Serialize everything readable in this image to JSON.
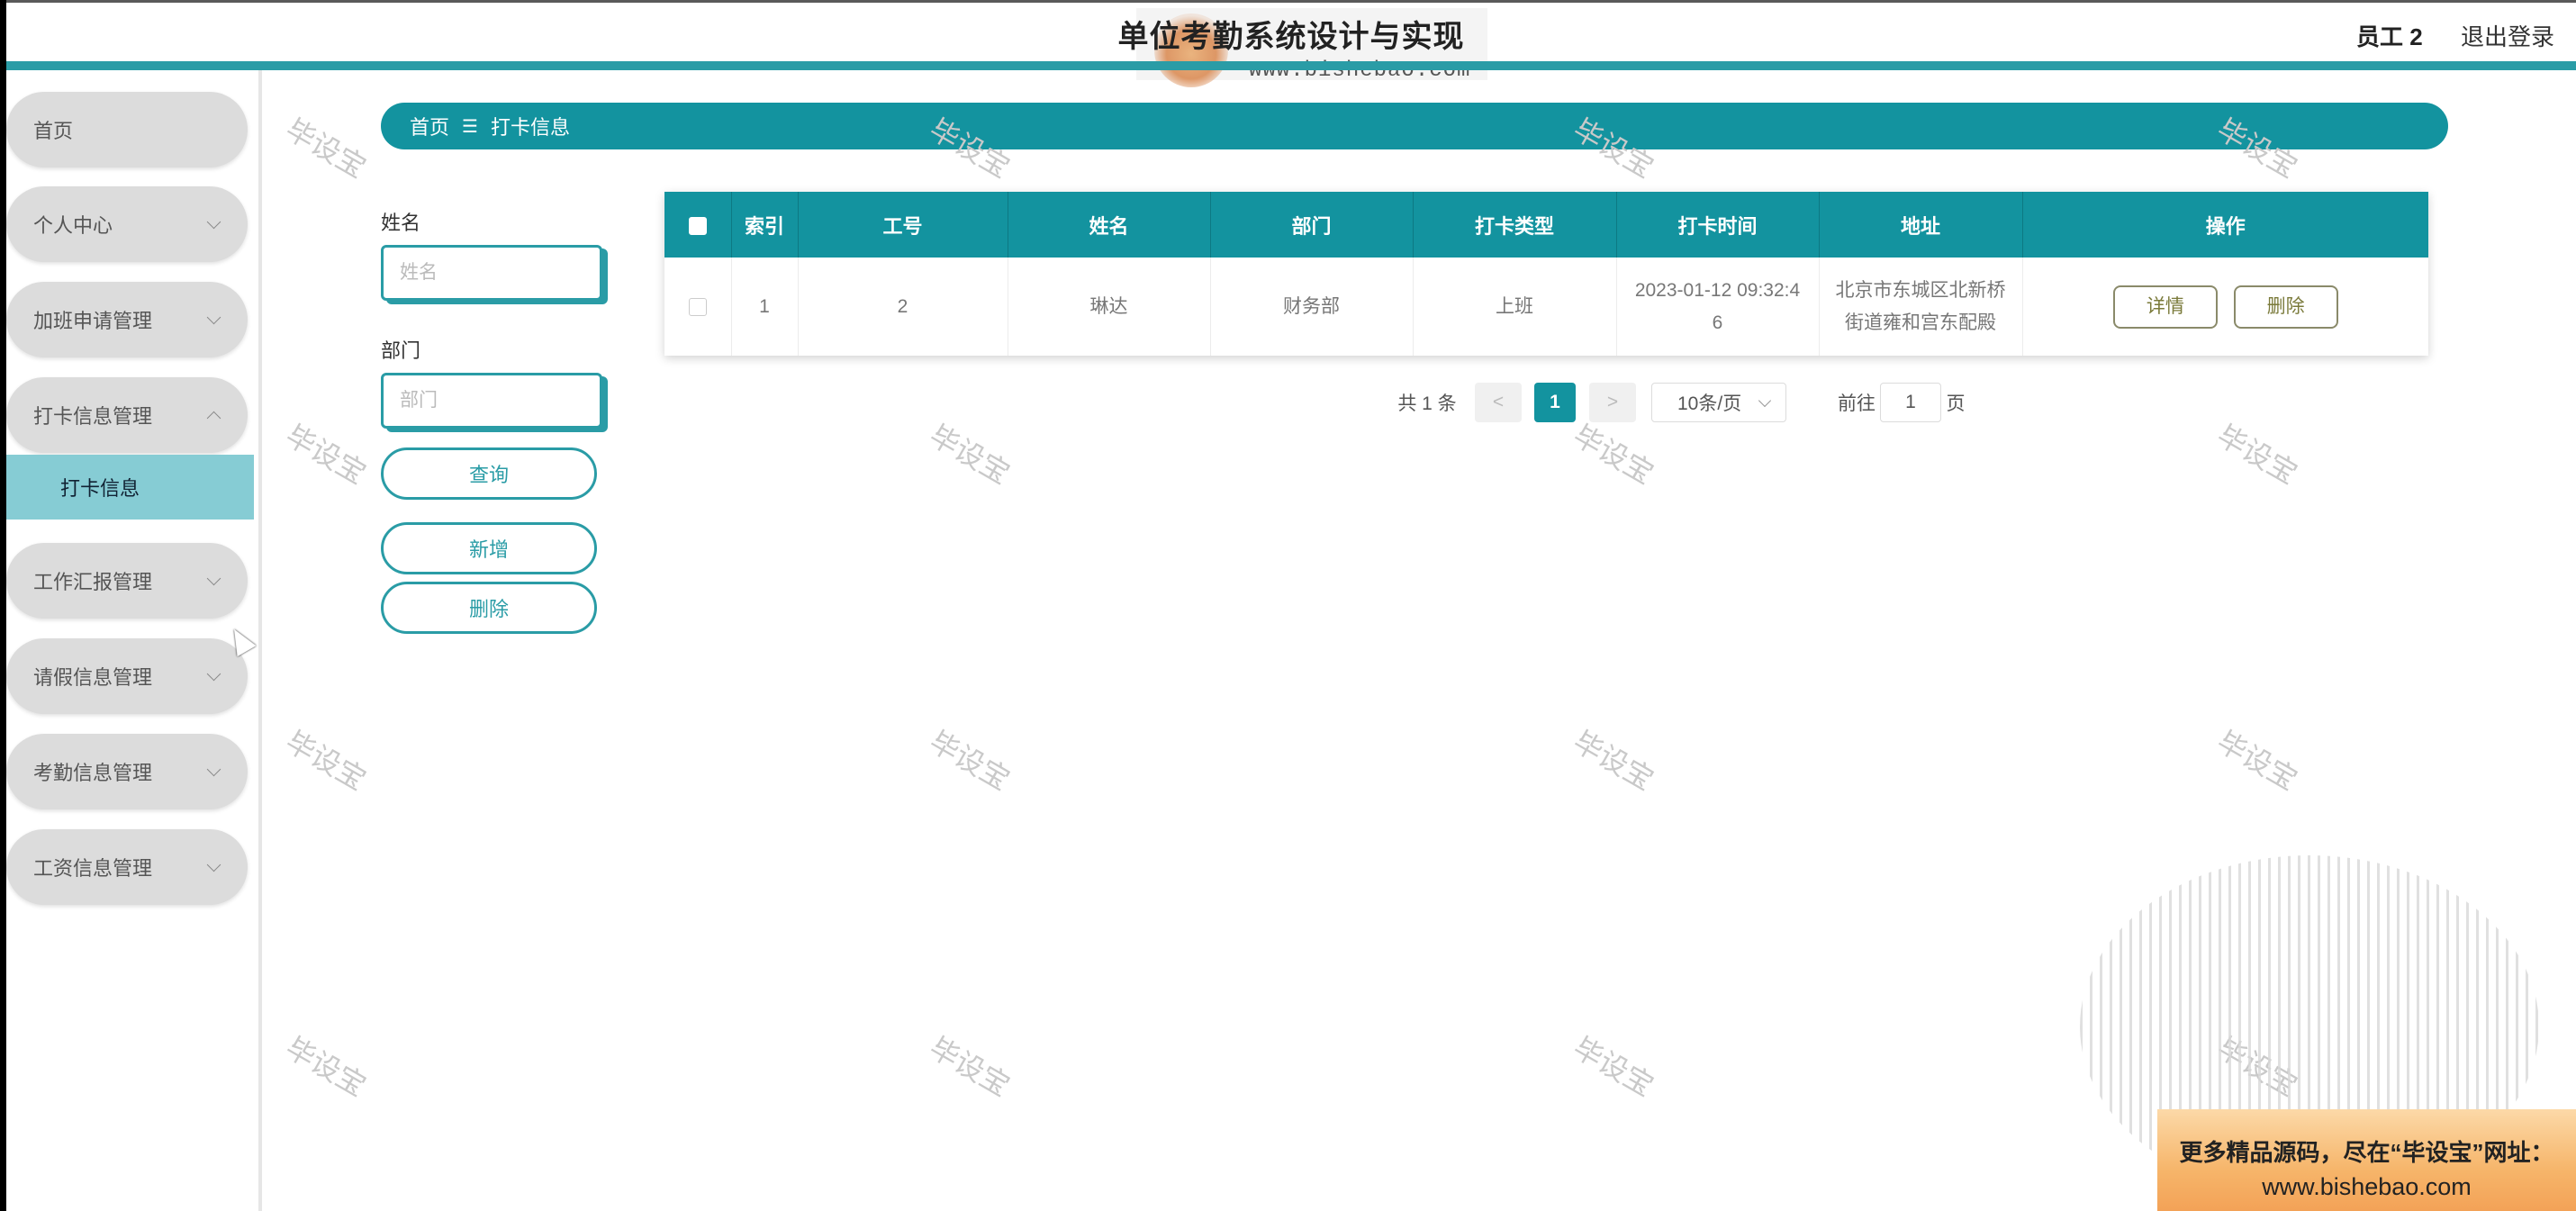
{
  "header": {
    "title": "单位考勤系统设计与实现",
    "watermark_url": "www.bishebao.com",
    "user": "员工 2",
    "logout": "退出登录"
  },
  "sidebar": {
    "items": [
      {
        "label": "首页"
      },
      {
        "label": "个人中心"
      },
      {
        "label": "加班申请管理"
      },
      {
        "label": "打卡信息管理"
      },
      {
        "label": "工作汇报管理"
      },
      {
        "label": "请假信息管理"
      },
      {
        "label": "考勤信息管理"
      },
      {
        "label": "工资信息管理"
      }
    ],
    "submenu": {
      "label": "打卡信息"
    }
  },
  "breadcrumb": {
    "home": "首页",
    "separator": "☰",
    "current": "打卡信息"
  },
  "search": {
    "name_label": "姓名",
    "name_placeholder": "姓名",
    "dept_label": "部门",
    "dept_placeholder": "部门",
    "query_btn": "查询",
    "add_btn": "新增",
    "delete_btn": "删除"
  },
  "table": {
    "headers": [
      "索引",
      "工号",
      "姓名",
      "部门",
      "打卡类型",
      "打卡时间",
      "地址",
      "操作"
    ],
    "rows": [
      {
        "index": "1",
        "emp_no": "2",
        "name": "琳达",
        "dept": "财务部",
        "type": "上班",
        "time_line1": "2023-01-12 09:32:4",
        "time_line2": "6",
        "addr_line1": "北京市东城区北新桥",
        "addr_line2": "街道雍和宫东配殿",
        "detail_btn": "详情",
        "delete_btn": "删除"
      }
    ]
  },
  "pagination": {
    "total": "共 1 条",
    "prev": "<",
    "current_page": "1",
    "next": ">",
    "page_size": "10条/页",
    "goto_prefix": "前往",
    "goto_value": "1",
    "goto_suffix": "页"
  },
  "watermark_text": "毕设宝",
  "promo": {
    "line1": "更多精品源码，尽在“毕设宝”网址：",
    "line2": "www.bishebao.com"
  }
}
